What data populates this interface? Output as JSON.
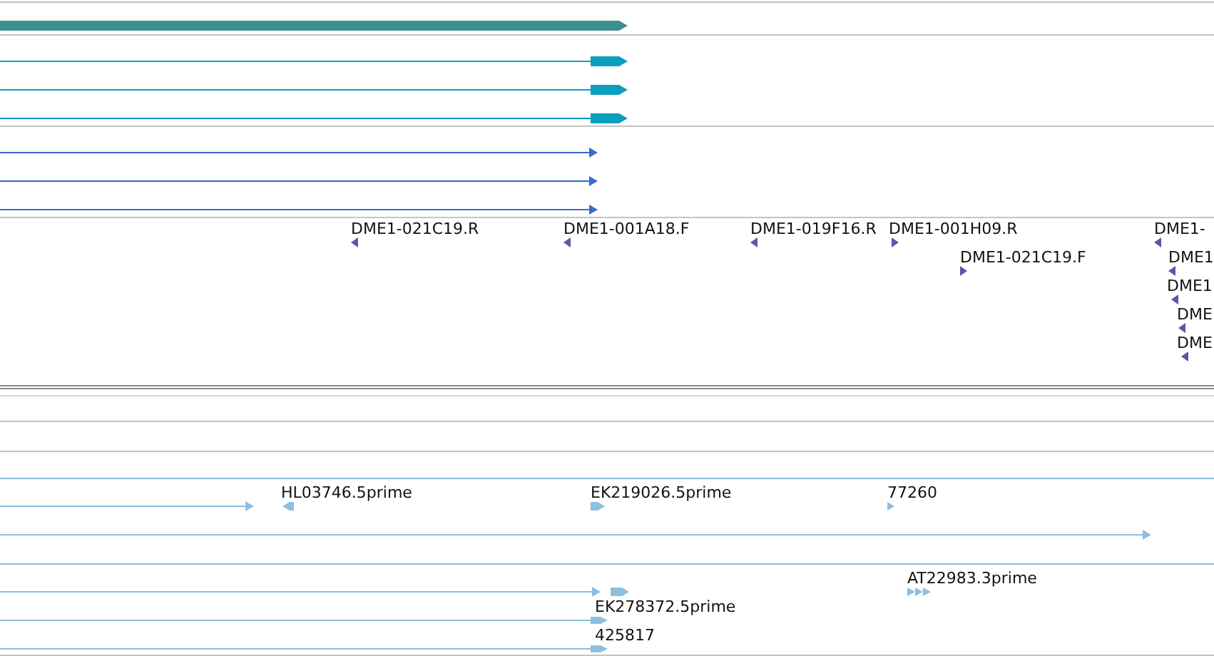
{
  "features": [
    {
      "kind": "bar",
      "reverse": false
    },
    {
      "kind": "exon-line",
      "reverse": false
    },
    {
      "kind": "exon-line",
      "reverse": false
    },
    {
      "kind": "exon-line",
      "reverse": false
    },
    {
      "kind": "line",
      "reverse": false
    },
    {
      "kind": "line",
      "reverse": false
    },
    {
      "kind": "line",
      "reverse": false
    },
    {
      "kind": "marker",
      "reverse": true,
      "label": "DME1-021C19.R"
    },
    {
      "kind": "marker",
      "reverse": true,
      "label": "DME1-001A18.F"
    },
    {
      "kind": "marker",
      "reverse": true,
      "label": "DME1-019F16.R"
    },
    {
      "kind": "marker",
      "reverse": false,
      "label": "DME1-001H09.R"
    },
    {
      "kind": "marker",
      "reverse": false,
      "label": "DME1-021C19.F"
    },
    {
      "kind": "marker",
      "reverse": true,
      "label": "DME1-"
    },
    {
      "kind": "marker",
      "reverse": true,
      "label": "DME1"
    },
    {
      "kind": "marker",
      "reverse": true,
      "label": "DME1"
    },
    {
      "kind": "marker",
      "reverse": true,
      "label": "DME"
    },
    {
      "kind": "marker",
      "reverse": true,
      "label": "DME"
    },
    {
      "kind": "est-line",
      "reverse": false
    },
    {
      "kind": "est-block",
      "reverse": true,
      "label": "HL03746.5prime"
    },
    {
      "kind": "est-block",
      "reverse": false,
      "label": "EK219026.5prime"
    },
    {
      "kind": "est-block",
      "reverse": false,
      "label": "77260"
    },
    {
      "kind": "est-line",
      "reverse": false
    },
    {
      "kind": "est-multi",
      "reverse": false,
      "label": "AT22983.3prime"
    },
    {
      "kind": "est-line",
      "reverse": false
    },
    {
      "kind": "est-block",
      "reverse": false
    },
    {
      "kind": "est-line",
      "reverse": false,
      "label": "EK278372.5prime"
    },
    {
      "kind": "est-line",
      "reverse": false,
      "label": "425817"
    }
  ]
}
